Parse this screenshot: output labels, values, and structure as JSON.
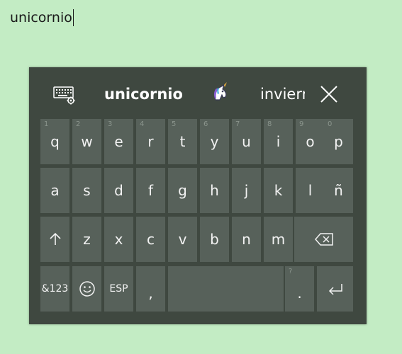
{
  "input": {
    "value": "unicornio"
  },
  "suggestions": {
    "primary": "unicornio",
    "emoji": "🦄",
    "third": "invierno"
  },
  "keys": {
    "row1": [
      {
        "hint": "1",
        "label": "q"
      },
      {
        "hint": "2",
        "label": "w"
      },
      {
        "hint": "3",
        "label": "e"
      },
      {
        "hint": "4",
        "label": "r"
      },
      {
        "hint": "5",
        "label": "t"
      },
      {
        "hint": "6",
        "label": "y"
      },
      {
        "hint": "7",
        "label": "u"
      },
      {
        "hint": "8",
        "label": "i"
      },
      {
        "hint": "9",
        "label": "o"
      },
      {
        "hint": "0",
        "label": "p"
      }
    ],
    "row2": [
      {
        "label": "a"
      },
      {
        "label": "s"
      },
      {
        "label": "d"
      },
      {
        "label": "f"
      },
      {
        "label": "g"
      },
      {
        "label": "h"
      },
      {
        "label": "j"
      },
      {
        "label": "k"
      },
      {
        "label": "l"
      },
      {
        "label": "ñ"
      }
    ],
    "row3": [
      {
        "label": "z"
      },
      {
        "label": "x"
      },
      {
        "label": "c"
      },
      {
        "label": "v"
      },
      {
        "label": "b"
      },
      {
        "label": "n"
      },
      {
        "label": "m"
      }
    ],
    "numbers_label": "&123",
    "language_label": "ESP",
    "comma_label": ",",
    "period_label": ".",
    "period_hint": "?"
  },
  "colors": {
    "background": "#c3ecc4",
    "keyboard": "#3f4840",
    "key": "#57615a",
    "text": "#ffffff"
  },
  "icons": [
    "keyboard-settings-icon",
    "close-icon",
    "shift-icon",
    "backspace-icon",
    "emoji-icon",
    "enter-icon"
  ]
}
